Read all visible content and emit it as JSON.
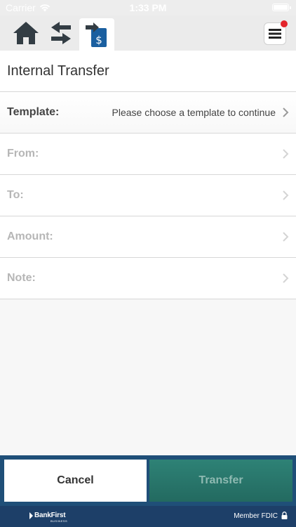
{
  "status_bar": {
    "carrier": "Carrier",
    "time": "1:33 PM"
  },
  "nav": {
    "home_icon": "home-icon",
    "transfer_icon": "swap-arrows-icon",
    "internal_transfer_icon": "dollar-transfer-icon",
    "menu_icon": "hamburger-menu-icon",
    "has_notification": true
  },
  "page": {
    "title": "Internal Transfer"
  },
  "form": {
    "rows": [
      {
        "label": "Template:",
        "value": "Please choose a template to continue",
        "enabled": true
      },
      {
        "label": "From:",
        "value": "",
        "enabled": false
      },
      {
        "label": "To:",
        "value": "",
        "enabled": false
      },
      {
        "label": "Amount:",
        "value": "",
        "enabled": false
      },
      {
        "label": "Note:",
        "value": "",
        "enabled": false
      }
    ]
  },
  "actions": {
    "cancel_label": "Cancel",
    "transfer_label": "Transfer"
  },
  "footer": {
    "brand": "BankFirst",
    "brand_sub": "BUSINESS",
    "fdic": "Member FDIC"
  },
  "colors": {
    "action_bar": "#1f4f78",
    "transfer_button": "#2e8276",
    "footer": "#1d3f68",
    "icon_dark": "#333d44",
    "icon_accent": "#1a5fa0",
    "notification": "#e3242b"
  }
}
